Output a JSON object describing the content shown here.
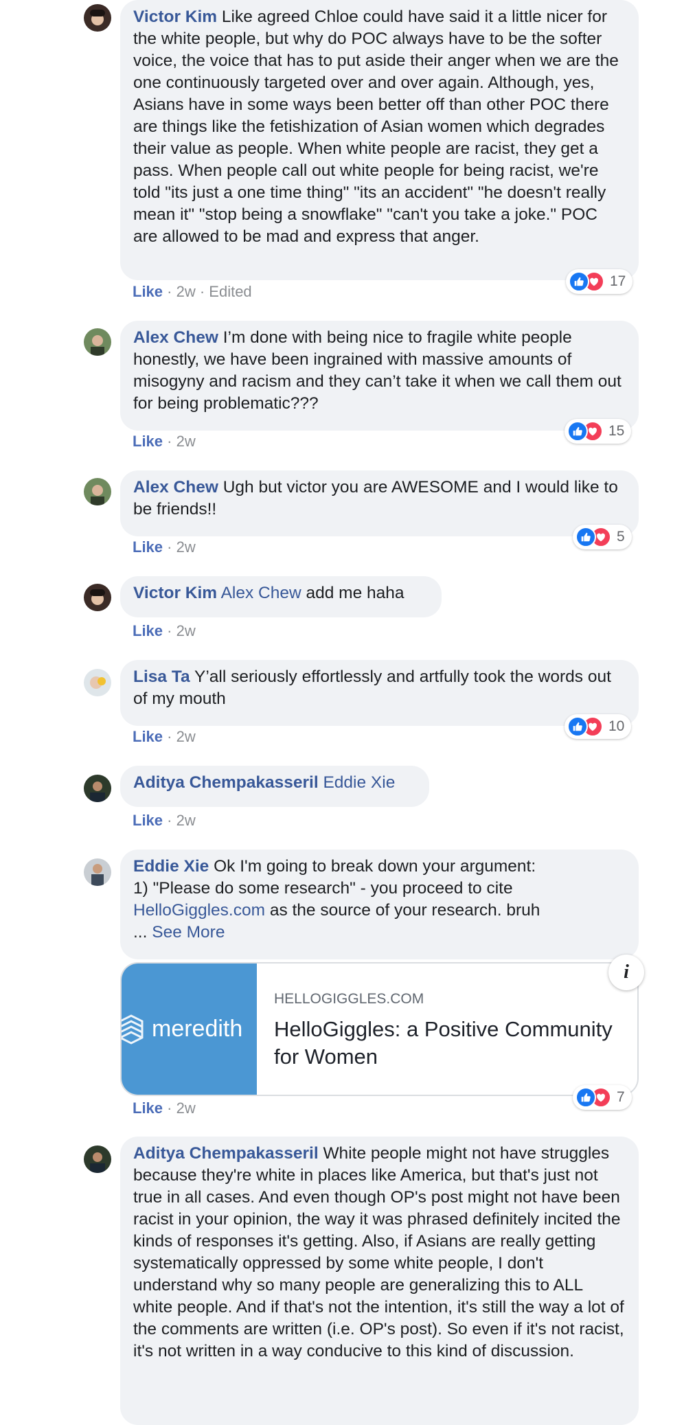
{
  "comments": [
    {
      "author": "Victor Kim",
      "text": "Like agreed Chloe could have said it a little nicer for the white people, but why do POC always have to be the softer voice, the voice that has to put aside their anger when we are the one continuously targeted over and over again. Although, yes, Asians have in some ways been better off than other POC there are things like the fetishization of Asian women which degrades their value as people. When white people are racist, they get a pass. When people call out white people for being racist, we're told \"its just a one time thing\" \"its an accident\" \"he doesn't really mean it\" \"stop being a snowflake\" \"can't you take a joke.\" POC are allowed to be mad and express that anger.",
      "like": "Like",
      "time": "2w",
      "edited": "Edited",
      "reactions": "17"
    },
    {
      "author": "Alex Chew",
      "text": "I’m done with being nice to fragile white people honestly, we have been ingrained with massive amounts of misogyny and racism and they can’t take it when we call them out for being problematic???",
      "like": "Like",
      "time": "2w",
      "reactions": "15"
    },
    {
      "author": "Alex Chew",
      "text": "Ugh but victor you are AWESOME and I would like to be friends!!",
      "like": "Like",
      "time": "2w",
      "reactions": "5"
    },
    {
      "author": "Victor Kim",
      "mention": "Alex Chew",
      "text": "add me haha",
      "like": "Like",
      "time": "2w"
    },
    {
      "author": "Lisa Ta",
      "text": "Y’all seriously effortlessly and artfully took the words out of my mouth",
      "like": "Like",
      "time": "2w",
      "reactions": "10"
    },
    {
      "author": "Aditya Chempakasseril",
      "mention": "Eddie Xie",
      "like": "Like",
      "time": "2w"
    },
    {
      "author": "Eddie Xie",
      "text": "Ok I'm going to break down your argument:",
      "text2": "1) \"Please do some research\" - you proceed to cite",
      "link": "HelloGiggles.com",
      "text3": "as the source of your research. bruh",
      "ellipsis": "...",
      "see_more": "See More",
      "like": "Like",
      "time": "2w",
      "reactions": "7",
      "card": {
        "thumb_text": "meredith",
        "domain": "HELLOGIGGLES.COM",
        "title": "HelloGiggles: a Positive Community for Women",
        "info": "i"
      }
    },
    {
      "author": "Aditya Chempakasseril",
      "text": "White people might not have struggles because they're white in places like America, but that's just not true in all cases. And even though OP's post might not have been racist in your opinion, the way it was phrased definitely incited the kinds of responses it's getting. Also, if Asians are really getting systematically oppressed by some white people, I don't understand why so many people are generalizing this to ALL white people. And if that's not the intention, it's still the way a lot of the comments are written (i.e. OP's post). So even if it's not racist, it's not written in a way conducive to this kind of discussion."
    }
  ],
  "colors": {
    "author": "#385898",
    "bubble": "#f0f2f5",
    "like_icon": "#1877f2",
    "love_icon": "#f33e58",
    "card_thumb": "#4b97d3"
  },
  "icons": {
    "like": "thumbs-up-icon",
    "love": "heart-icon"
  }
}
